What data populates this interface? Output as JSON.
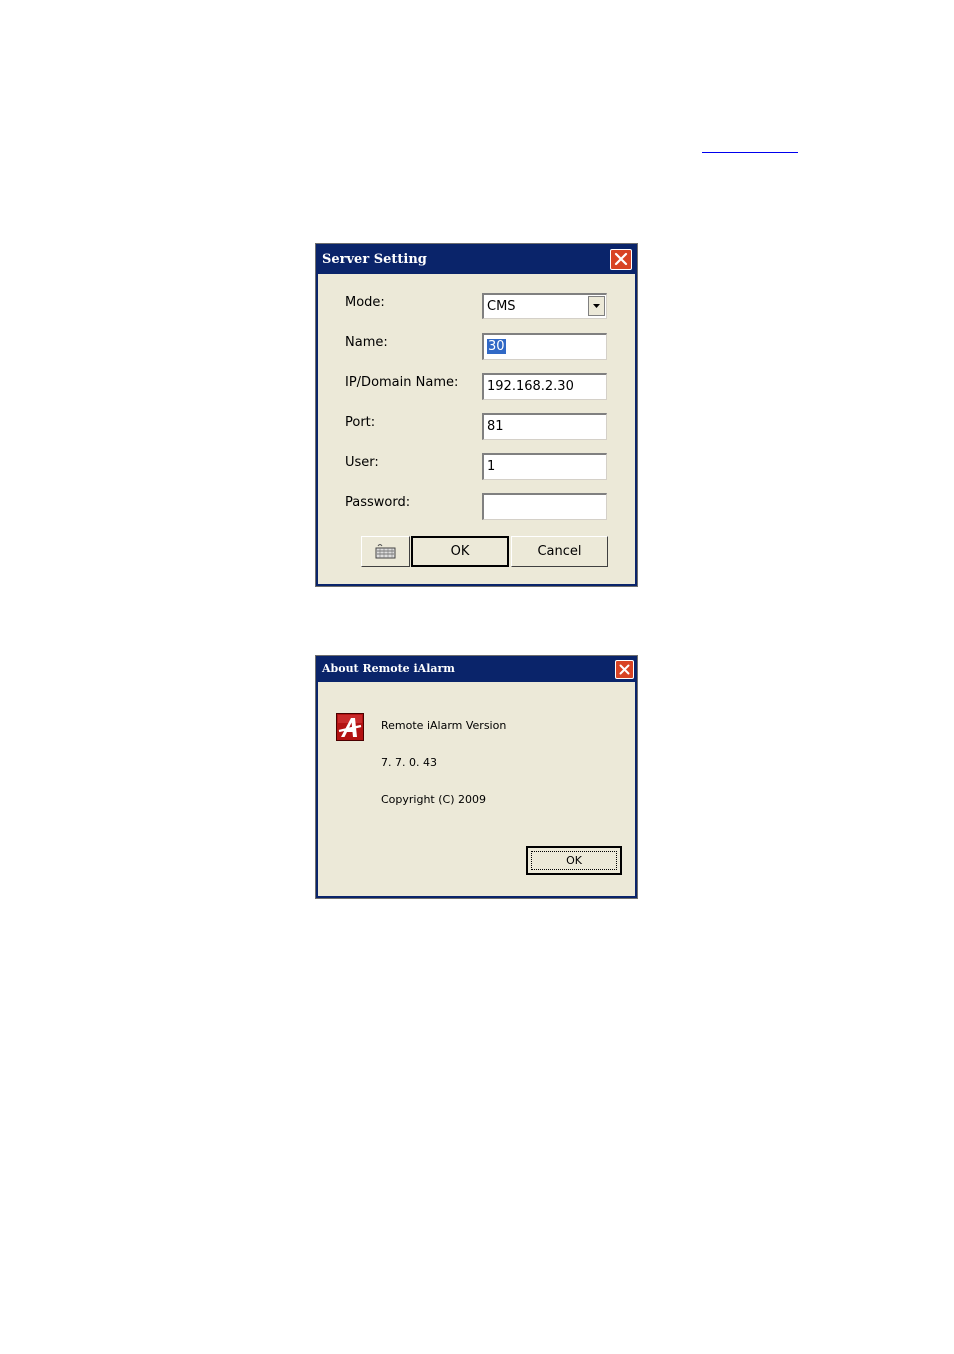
{
  "server_dialog": {
    "title": "Server Setting",
    "mode_label": "Mode:",
    "mode_value": "CMS",
    "name_label": "Name:",
    "name_value": "30",
    "ip_label": "IP/Domain Name:",
    "ip_value": "192.168.2.30",
    "port_label": "Port:",
    "port_value": "81",
    "user_label": "User:",
    "user_value": "1",
    "password_label": "Password:",
    "password_value": "",
    "ok_label": "OK",
    "cancel_label": "Cancel",
    "keyboard_icon": "keyboard-icon"
  },
  "about_dialog": {
    "title": "About Remote iAlarm",
    "product_line": "Remote iAlarm Version",
    "version": "7. 7. 0. 43",
    "copyright": "Copyright (C) 2009",
    "ok_label": "OK",
    "app_icon": "remote-ialarm-logo-icon"
  },
  "colors": {
    "titlebar": "#0a246a",
    "dialog_bg": "#ece9d8",
    "close_button": "#d84324",
    "link": "#0000ee",
    "selection": "#3169c6"
  }
}
